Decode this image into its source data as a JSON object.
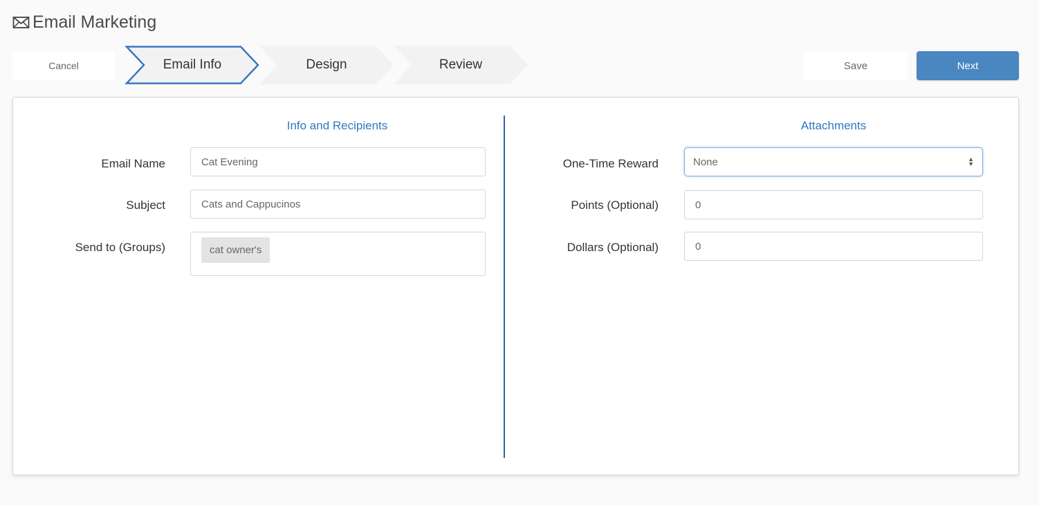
{
  "header": {
    "icon": "envelope-icon",
    "title": "Email Marketing"
  },
  "wizard": {
    "cancel_label": "Cancel",
    "steps": [
      {
        "label": "Email Info",
        "active": true
      },
      {
        "label": "Design",
        "active": false
      },
      {
        "label": "Review",
        "active": false
      }
    ],
    "save_label": "Save",
    "next_label": "Next"
  },
  "colors": {
    "accent": "#4a86c0",
    "active_step_border": "#3b78bd",
    "section_title": "#2d78c2",
    "divider": "#2d66a3"
  },
  "info": {
    "title": "Info and Recipients",
    "email_name": {
      "label": "Email Name",
      "value": "Cat Evening"
    },
    "subject": {
      "label": "Subject",
      "value": "Cats and Cappucinos"
    },
    "send_to": {
      "label": "Send to (Groups)",
      "tags": [
        "cat owner's"
      ]
    }
  },
  "attachments": {
    "title": "Attachments",
    "reward": {
      "label": "One-Time Reward",
      "selected": "None"
    },
    "points": {
      "label": "Points (Optional)",
      "value": "0"
    },
    "dollars": {
      "label": "Dollars (Optional)",
      "value": "0"
    }
  }
}
